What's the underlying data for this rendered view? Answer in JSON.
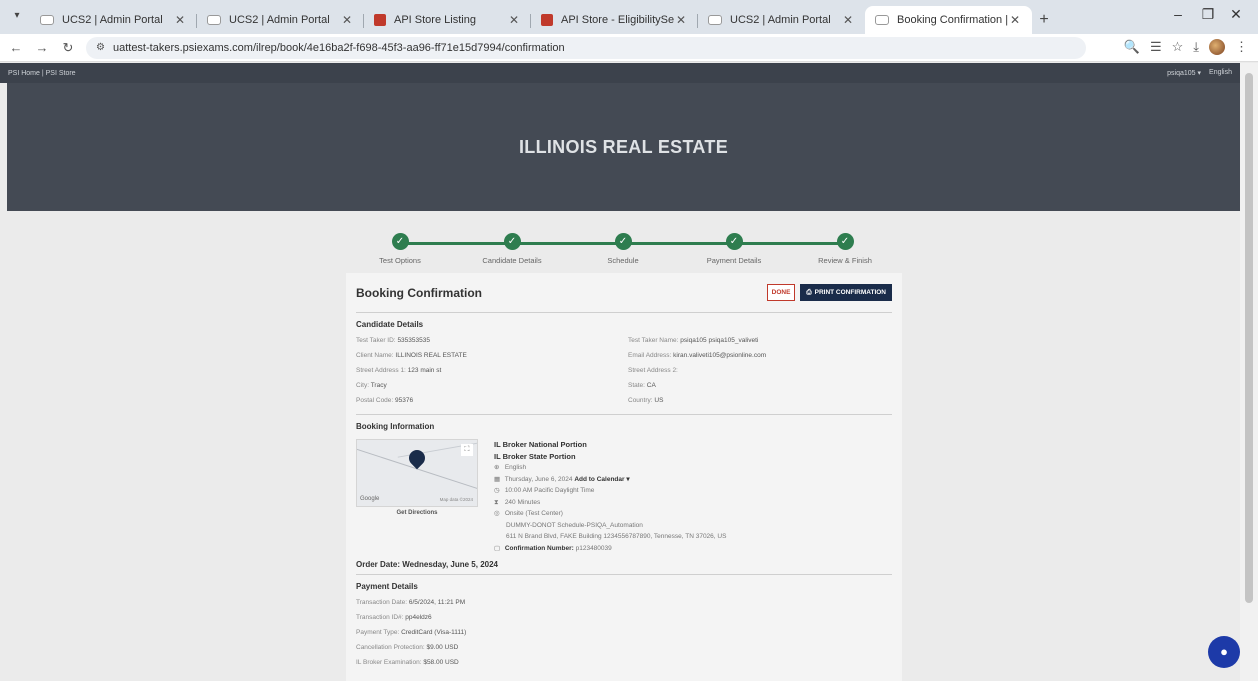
{
  "browser": {
    "tabs": [
      {
        "label": "UCS2 | Admin Portal",
        "favicon": "psi"
      },
      {
        "label": "UCS2 | Admin Portal",
        "favicon": "psi"
      },
      {
        "label": "API Store Listing",
        "favicon": "api"
      },
      {
        "label": "API Store - EligibilityService",
        "favicon": "api"
      },
      {
        "label": "UCS2 | Admin Portal",
        "favicon": "psi"
      },
      {
        "label": "Booking Confirmation | PSI Onl",
        "favicon": "psi",
        "active": true
      }
    ],
    "url": "uattest-takers.psiexams.com/ilrep/book/4e16ba2f-f698-45f3-aa96-ff71e15d7994/confirmation"
  },
  "topstrip": {
    "left": "PSI Home  |  PSI Store",
    "user": "psiqa105 ▾",
    "lang": "English"
  },
  "hero": {
    "title": "ILLINOIS REAL ESTATE"
  },
  "stepper": [
    "Test Options",
    "Candidate Details",
    "Schedule",
    "Payment Details",
    "Review & Finish"
  ],
  "card": {
    "title": "Booking Confirmation",
    "done_label": "DONE",
    "print_label": "PRINT CONFIRMATION",
    "candidate": {
      "title": "Candidate Details",
      "test_taker_id_label": "Test Taker ID:",
      "test_taker_id": "535353535",
      "name_label": "Test Taker Name:",
      "name": "psiqa105 psiqa105_valiveti",
      "client_label": "Client Name:",
      "client": "ILLINOIS REAL ESTATE",
      "email_label": "Email Address:",
      "email": "kiran.valiveti105@psionline.com",
      "street1_label": "Street Address 1:",
      "street1": "123 main st",
      "street2_label": "Street Address 2:",
      "city_label": "City:",
      "city": "Tracy",
      "state_label": "State:",
      "state": "CA",
      "postal_label": "Postal Code:",
      "postal": "95376",
      "country_label": "Country:",
      "country": "US"
    },
    "booking": {
      "title": "Booking Information",
      "get_directions": "Get Directions",
      "map_logo": "Google",
      "map_data": "Map data ©2024",
      "exam1": "IL Broker National Portion",
      "exam2": "IL Broker State Portion",
      "language": "English",
      "date": "Thursday, June 6, 2024",
      "add_calendar": "Add to Calendar ▾",
      "time": "10:00 AM Pacific Daylight Time",
      "duration": "240 Minutes",
      "location_type": "Onsite (Test Center)",
      "center_name": "DUMMY-DONOT Schedule-PSIQA_Automation",
      "address": "611 N Brand Blvd, FAKE Building 1234556787890, Tennesse, TN 37026, US",
      "confirmation_label": "Confirmation Number:",
      "confirmation": "p123480039"
    },
    "order_date": "Order Date: Wednesday, June 5, 2024",
    "payment": {
      "title": "Payment Details",
      "transaction_date_label": "Transaction Date:",
      "transaction_date": "6/5/2024, 11:21 PM",
      "transaction_id_label": "Transaction ID#:",
      "transaction_id": "pp4eldz6",
      "payment_type_label": "Payment Type:",
      "payment_type": "CreditCard (Visa-1111)",
      "cancellation_label": "Cancellation Protection:",
      "cancellation": "$9.00 USD",
      "exam_fee_label": "IL Broker Examination:",
      "exam_fee": "$58.00 USD"
    }
  }
}
